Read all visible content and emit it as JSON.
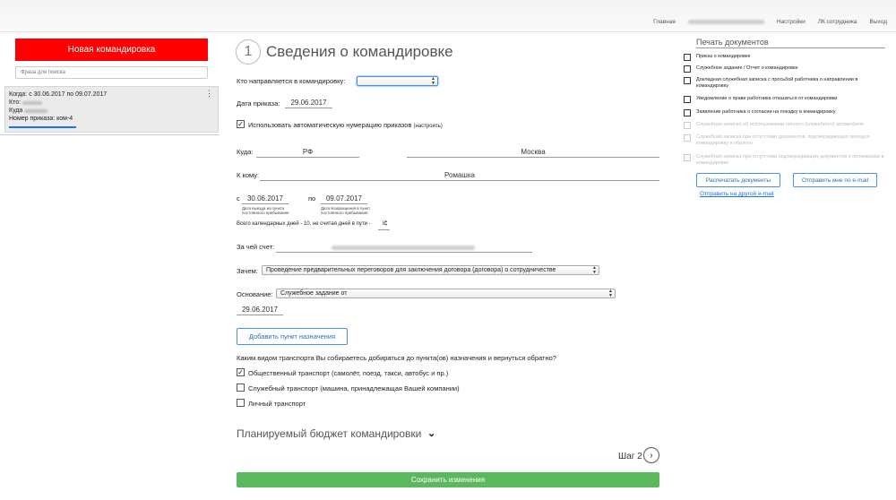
{
  "nav": {
    "home": "Главная",
    "settings": "Настройки",
    "cabinet": "ЛК сотрудника",
    "logout": "Выход"
  },
  "sidebar": {
    "new_trip": "Новая командировка",
    "search_placeholder": "Фраза для поиска",
    "trip": {
      "when": "Когда: с 30.06.2017 по 09.07.2017",
      "who": "Кто:",
      "where": "Куда",
      "order": "Номер приказа: ком-4"
    }
  },
  "main": {
    "step_number": "1",
    "title": "Сведения о командировке",
    "who_label": "Кто направляется в командировку:",
    "order_date_label": "Дата приказа:",
    "order_date": "29.06.2017",
    "auto_numbering": "Использовать автоматическую нумерацию приказов",
    "auto_numbering_link": "(настроить)",
    "where_label": "Куда:",
    "country": "РФ",
    "city": "Москва",
    "to_whom_label": "К кому:",
    "to_whom": "Ромашка",
    "from_label": "с",
    "from_date": "30.06.2017",
    "from_note": "Дата выезда из пункта постоянного пребывания",
    "to_label": "по",
    "to_date": "09.07.2017",
    "to_note": "Дата возвращения в пункт постоянного пребывания",
    "days_text": "Всего календарных дней - 10, не считая дней в пути -",
    "days_in_transit": "8",
    "payer_label": "За чей счет:",
    "purpose_label": "Зачем:",
    "purpose_value": "Проведение предварительных переговоров для заключения договора (договора) о сотрудничестве",
    "basis_label": "Основание:",
    "basis_value": "Служебное задание от",
    "basis_date": "29.06.2017",
    "add_destination": "Добавить пункт назначения",
    "transport_question": "Каким видом транспорта Вы собираетесь добираться до пункта(ов) назначения и вернуться обратно?",
    "transport": [
      {
        "label": "Общественный транспорт (самолёт, поезд, такси, автобус и пр.)",
        "checked": true
      },
      {
        "label": "Служебный транспорт (машина, принадлежащая Вашей компании)",
        "checked": false
      },
      {
        "label": "Личный транспорт",
        "checked": false
      }
    ],
    "budget_title": "Планируемый бюджет командировки",
    "step_label": "Шаг 2",
    "save": "Сохранить изменения"
  },
  "right": {
    "print_title": "Печать документов",
    "docs": [
      {
        "label": "Приказ о командировке",
        "enabled": true
      },
      {
        "label": "Служебное задание / Отчет о командировке",
        "enabled": true
      },
      {
        "label": "Докладная служебная записка с просьбой работника о направлении в командировку",
        "enabled": true
      },
      {
        "label": "Уведомление о праве работника отказаться от командировки",
        "enabled": true
      },
      {
        "label": "Заявление работника о согласии на поездку в командировку",
        "enabled": true
      },
      {
        "label": "Служебная записка об использовании личного (служебного) автомобиля",
        "enabled": false
      },
      {
        "label": "Служебная записка при отсутствии документов, подтверждающих проезд в командировку и обратно",
        "enabled": false
      },
      {
        "label": "Служебная записка при отсутствии подтверждающих документов о проживании в командировке",
        "enabled": false
      }
    ],
    "print_btn": "Распечатать документы",
    "send_me_btn": "Отправить мне по e-mail",
    "send_other": "Отправить на другой e-mail"
  }
}
